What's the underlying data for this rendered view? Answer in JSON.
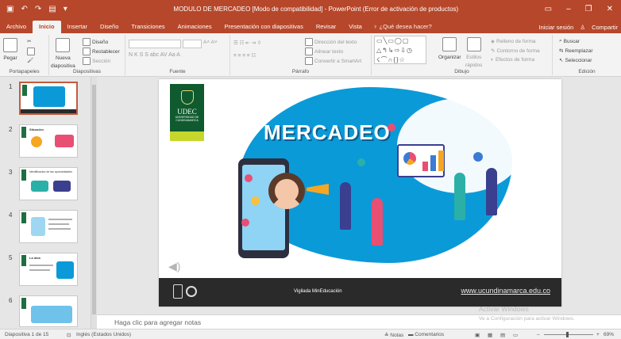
{
  "window": {
    "title": "MODULO DE MERCADEO [Modo de compatibilidad] - PowerPoint (Error de activación de productos)"
  },
  "tabs": [
    "Archivo",
    "Inicio",
    "Insertar",
    "Diseño",
    "Transiciones",
    "Animaciones",
    "Presentación con diapositivas",
    "Revisar",
    "Vista"
  ],
  "active_tab": "Inicio",
  "tell_me": "¿Qué desea hacer?",
  "account": {
    "signin": "Iniciar sesión",
    "share": "Compartir"
  },
  "ribbon": {
    "clipboard": {
      "paste": "Pegar",
      "label": "Portapapeles"
    },
    "slides": {
      "new_slide": "Nueva",
      "new_slide2": "diapositiva",
      "layout": "Diseño",
      "reset": "Restablecer",
      "section": "Sección",
      "label": "Diapositivas"
    },
    "font": {
      "label": "Fuente",
      "row2": "N  K  S  S  abc  AV  Aa  A"
    },
    "paragraph": {
      "text_direction": "Dirección del texto",
      "align_text": "Alinear texto",
      "smartart": "Convertir a SmartArt",
      "label": "Párrafo"
    },
    "drawing": {
      "organize": "Organizar",
      "styles": "Estilos",
      "quick": "rápidos",
      "fill": "Relleno de forma",
      "outline": "Contorno de forma",
      "effects": "Efectos de forma",
      "label": "Dibujo"
    },
    "editing": {
      "find": "Buscar",
      "replace": "Reemplazar",
      "select": "Seleccionar",
      "label": "Edición"
    }
  },
  "thumbnails": [
    {
      "num": "1",
      "title": ""
    },
    {
      "num": "2",
      "title": "Situación"
    },
    {
      "num": "3",
      "title": "Identificación de las oportunidades"
    },
    {
      "num": "4",
      "title": ""
    },
    {
      "num": "5",
      "title": "La idea"
    },
    {
      "num": "6",
      "title": ""
    }
  ],
  "slide": {
    "logo_name": "UDEC",
    "logo_sub": "UNIVERSIDAD DE CUNDINAMARCA",
    "headline": "MERCADEO",
    "footer_vigilada": "Vigilada MinEducación",
    "footer_url": "www.ucundinamarca.edu.co"
  },
  "notes_placeholder": "Haga clic para agregar notas",
  "activation": {
    "line1": "Activar Windows",
    "line2": "Ve a Configuración para activar Windows."
  },
  "status": {
    "slide_count": "Diapositiva 1 de 15",
    "language": "Inglés (Estados Unidos)",
    "notes": "Notas",
    "comments": "Comentarios",
    "zoom": "69%"
  },
  "colors": {
    "accent": "#b7472a",
    "slide_blue": "#0b9ad8",
    "udec_green": "#0f5a2e"
  }
}
